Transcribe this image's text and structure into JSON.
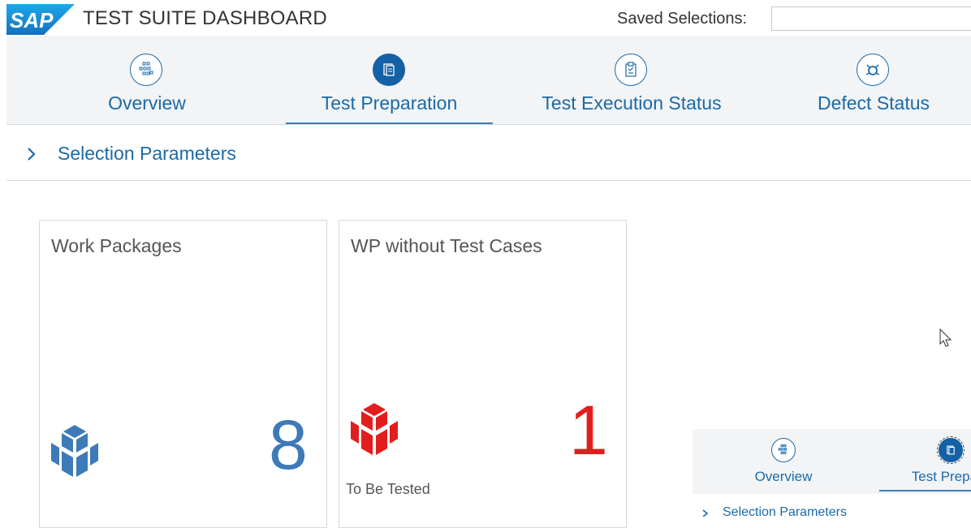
{
  "header": {
    "logo_text": "SAP",
    "title": "TEST SUITE DASHBOARD",
    "saved_selections_label": "Saved Selections:",
    "saved_selections_value": ""
  },
  "tabs": [
    {
      "label": "Overview",
      "icon": "overview-icon",
      "active": false
    },
    {
      "label": "Test Preparation",
      "icon": "test-preparation-icon",
      "active": true
    },
    {
      "label": "Test Execution Status",
      "icon": "clipboard-icon",
      "active": false
    },
    {
      "label": "Defect Status",
      "icon": "bug-icon",
      "active": false
    }
  ],
  "selection": {
    "label": "Selection Parameters"
  },
  "cards": [
    {
      "title": "Work Packages",
      "value": "8",
      "subtitle": "",
      "icon": "cube-icon",
      "color": "#3d7ab8"
    },
    {
      "title": "WP without Test Cases",
      "value": "1",
      "subtitle": "To Be Tested",
      "icon": "cube-icon",
      "color": "#e31d1d"
    }
  ],
  "thumbnail": {
    "tabs": [
      {
        "label": "Overview"
      },
      {
        "label": "Test Prepara"
      }
    ],
    "selection_label": "Selection Parameters"
  },
  "colors": {
    "accent": "#1a6aa8",
    "active_tab": "#1461a5",
    "nav_bg": "#f2f4f6",
    "logo": "#1a8ed8"
  }
}
